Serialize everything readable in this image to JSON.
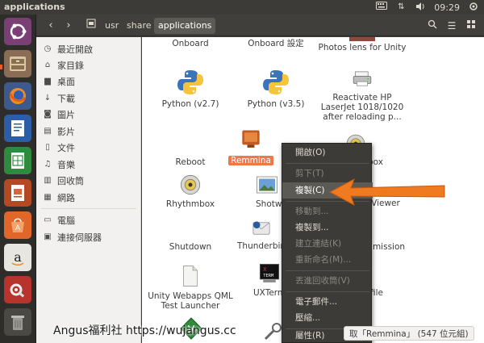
{
  "window": {
    "title": "applications"
  },
  "tray": {
    "keyboard_icon": "keyboard-icon",
    "network_icon": "network-arrows-icon",
    "volume_icon": "volume-icon",
    "time": "09:29",
    "power_icon": "gear-power-icon"
  },
  "toolbar": {
    "back_icon": "chevron-left-icon",
    "forward_icon": "chevron-right-icon",
    "breadcrumbs": [
      "usr",
      "share",
      "applications"
    ],
    "active_crumb": "applications"
  },
  "sidebar": {
    "items": [
      {
        "label": "最近開啟",
        "icon": "clock-icon"
      },
      {
        "label": "家目錄",
        "icon": "home-icon"
      },
      {
        "label": "桌面",
        "icon": "folder-icon"
      },
      {
        "label": "下載",
        "icon": "download-icon"
      },
      {
        "label": "圖片",
        "icon": "camera-icon"
      },
      {
        "label": "影片",
        "icon": "film-icon"
      },
      {
        "label": "文件",
        "icon": "document-icon"
      },
      {
        "label": "音樂",
        "icon": "music-icon"
      },
      {
        "label": "回收筒",
        "icon": "trash-icon"
      },
      {
        "label": "網路",
        "icon": "network-icon"
      },
      {
        "label": "電腦",
        "icon": "computer-icon"
      },
      {
        "label": "連接伺服器",
        "icon": "server-icon"
      }
    ]
  },
  "files": [
    {
      "name": "Onboard"
    },
    {
      "name": "Onboard 設定"
    },
    {
      "name": "Photos lens for Unity"
    },
    {
      "name": "Python (v2.7)"
    },
    {
      "name": "Python (v3.5)"
    },
    {
      "name": "Reactivate HP LaserJet 1018/1020 after reloading p..."
    },
    {
      "name": "Reboot"
    },
    {
      "name": "Remmina"
    },
    {
      "name": "Rhythmbox"
    },
    {
      "name": "Rhythmbox"
    },
    {
      "name": "Shotwell"
    },
    {
      "name": "Viewer"
    },
    {
      "name": "Shutdown"
    },
    {
      "name": "Thunderbird"
    },
    {
      "name": "mission"
    },
    {
      "name": "Unity Webapps QML Test Launcher"
    },
    {
      "name": "UXTerm"
    },
    {
      "name": "file"
    }
  ],
  "context_menu": {
    "items": [
      {
        "label": "開啟(O)",
        "enabled": true
      },
      {
        "label": "剪下(T)",
        "enabled": false
      },
      {
        "label": "複製(C)",
        "enabled": true,
        "highlighted": true
      },
      {
        "label": "移動到...",
        "enabled": false
      },
      {
        "label": "複製到...",
        "enabled": true
      },
      {
        "label": "建立連結(K)",
        "enabled": false
      },
      {
        "label": "重新命名(M)...",
        "enabled": false
      },
      {
        "label": "丟進回收筒(V)",
        "enabled": false
      },
      {
        "label": "電子郵件...",
        "enabled": true
      },
      {
        "label": "壓縮...",
        "enabled": true
      },
      {
        "label": "屬性(R)",
        "enabled": true
      }
    ]
  },
  "status_bar": {
    "text": "取「Remmina」 (547 位元組)"
  },
  "watermark": {
    "text": "Angus福利社 https://wujangus.cc"
  },
  "colors": {
    "accent": "#ea5c2c",
    "panel": "#3c3b37",
    "sidebar": "#f2f1f0",
    "arrow": "#f07a1f"
  }
}
